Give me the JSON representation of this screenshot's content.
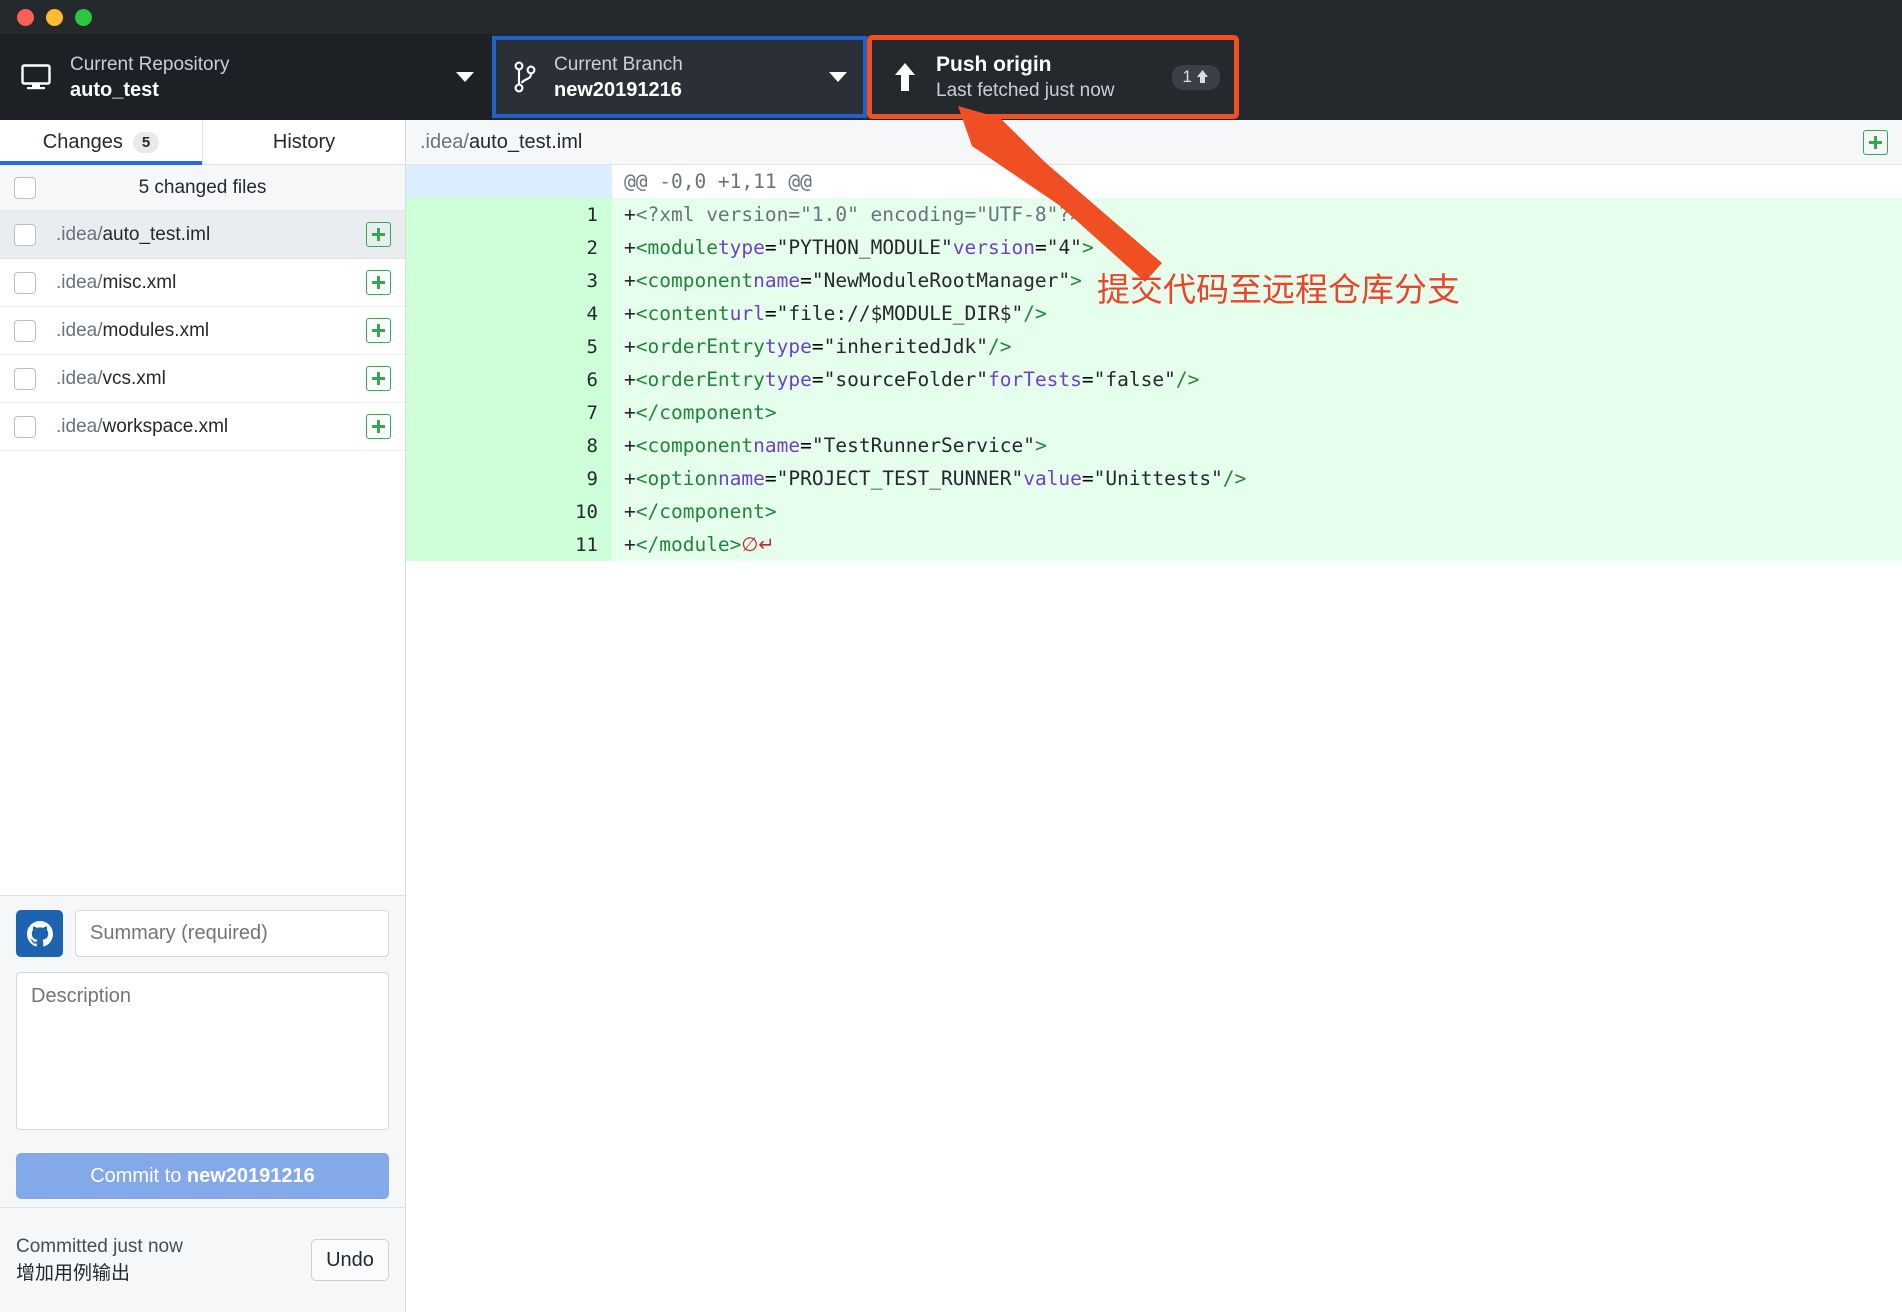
{
  "window": {
    "traffic_lights": [
      "close",
      "minimize",
      "maximize"
    ]
  },
  "toolbar": {
    "repository": {
      "icon": "monitor-icon",
      "label": "Current Repository",
      "value": "auto_test",
      "dropdown_icon": "chevron-down-icon"
    },
    "branch": {
      "icon": "branch-icon",
      "label": "Current Branch",
      "value": "new20191216",
      "dropdown_icon": "chevron-down-icon",
      "highlight_color": "#2262c6"
    },
    "push": {
      "icon": "arrow-up-icon",
      "label": "Push origin",
      "subtitle": "Last fetched just now",
      "badge_count": "1",
      "badge_icon": "arrow-up-icon",
      "highlight_color": "#f04e23"
    }
  },
  "sidebar": {
    "tabs": [
      {
        "label": "Changes",
        "badge": "5",
        "active": true
      },
      {
        "label": "History",
        "badge": "",
        "active": false
      }
    ],
    "changed_files_header": "5 changed files",
    "files": [
      {
        "dir": ".idea/",
        "name": "auto_test.iml",
        "status": "added",
        "selected": true
      },
      {
        "dir": ".idea/",
        "name": "misc.xml",
        "status": "added",
        "selected": false
      },
      {
        "dir": ".idea/",
        "name": "modules.xml",
        "status": "added",
        "selected": false
      },
      {
        "dir": ".idea/",
        "name": "vcs.xml",
        "status": "added",
        "selected": false
      },
      {
        "dir": ".idea/",
        "name": "workspace.xml",
        "status": "added",
        "selected": false
      }
    ],
    "commit": {
      "avatar_icon": "github-avatar-icon",
      "summary_placeholder": "Summary (required)",
      "summary_value": "",
      "description_placeholder": "Description",
      "description_value": "",
      "button_prefix": "Commit to ",
      "button_branch": "new20191216"
    },
    "footer": {
      "status_line": "Committed just now",
      "commit_message": "增加用例输出",
      "undo_label": "Undo"
    }
  },
  "diff": {
    "header": {
      "path_dir": ".idea/",
      "path_file": "auto_test.iml",
      "action_icon": "plus-box-icon"
    },
    "hunk_header": "@@ -0,0 +1,11 @@",
    "lines": [
      {
        "n": "1",
        "marker": "+",
        "indent": "",
        "text": "<?xml version=\"1.0\" encoding=\"UTF-8\"?>"
      },
      {
        "n": "2",
        "marker": "+",
        "indent": "",
        "text": "<module type=\"PYTHON_MODULE\" version=\"4\">"
      },
      {
        "n": "3",
        "marker": "+",
        "indent": "  ",
        "text": "<component name=\"NewModuleRootManager\">"
      },
      {
        "n": "4",
        "marker": "+",
        "indent": "    ",
        "text": "<content url=\"file://$MODULE_DIR$\" />"
      },
      {
        "n": "5",
        "marker": "+",
        "indent": "    ",
        "text": "<orderEntry type=\"inheritedJdk\" />"
      },
      {
        "n": "6",
        "marker": "+",
        "indent": "    ",
        "text": "<orderEntry type=\"sourceFolder\" forTests=\"false\" />"
      },
      {
        "n": "7",
        "marker": "+",
        "indent": "  ",
        "text": "</component>"
      },
      {
        "n": "8",
        "marker": "+",
        "indent": "  ",
        "text": "<component name=\"TestRunnerService\">"
      },
      {
        "n": "9",
        "marker": "+",
        "indent": "    ",
        "text": "<option name=\"PROJECT_TEST_RUNNER\" value=\"Unittests\" />"
      },
      {
        "n": "10",
        "marker": "+",
        "indent": "  ",
        "text": "</component>"
      },
      {
        "n": "11",
        "marker": "+",
        "indent": "",
        "text": "</module>",
        "no_newline": true
      }
    ]
  },
  "annotation": {
    "text": "提交代码至远程仓库分支",
    "color": "#e8452a",
    "arrow": "arrow-pointing-to-push-origin"
  }
}
